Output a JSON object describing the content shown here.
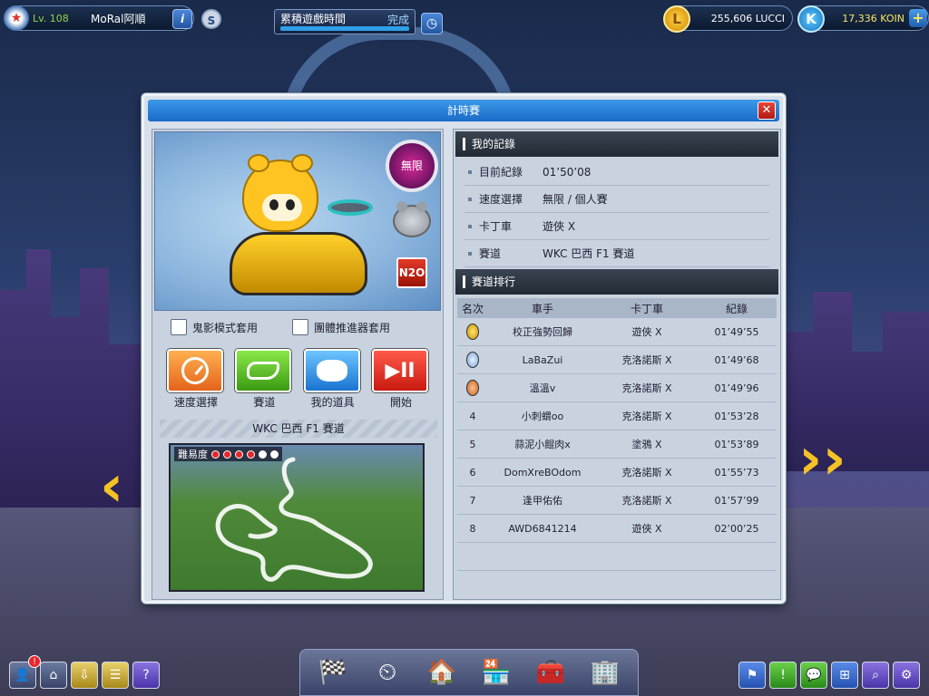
{
  "topbar": {
    "level": "Lv. 108",
    "nickname": "MoRal阿順",
    "quest_text": "累積遊戲時間",
    "quest_status": "完成",
    "quest_progress": 1.0,
    "lucci": "255,606 LUCCI",
    "koin": "17,336 KOIN",
    "lucci_symbol": "L",
    "koin_symbol": "K",
    "info_symbol": "i",
    "s_symbol": "S"
  },
  "window": {
    "title": "計時賽",
    "close_symbol": "✕",
    "kart": {
      "speed_badge": "無限",
      "n2o_badge": "N2O"
    },
    "checkboxes": [
      {
        "label": "鬼影模式套用",
        "checked": false
      },
      {
        "label": "團體推進器套用",
        "checked": false
      }
    ],
    "actions": [
      {
        "label": "速度選擇",
        "icon": "speed-gauge-icon"
      },
      {
        "label": "賽道",
        "icon": "track-icon"
      },
      {
        "label": "我的道具",
        "icon": "item-icon"
      },
      {
        "label": "開始",
        "icon": "start-icon"
      }
    ],
    "start_symbol": "▶II",
    "track_name": "WKC 巴西 F1 賽道",
    "difficulty": {
      "label": "難易度",
      "level": 4,
      "max": 6
    },
    "my_record": {
      "heading": "我的記錄",
      "rows": [
        {
          "key": "目前紀錄",
          "value": "01’50’08"
        },
        {
          "key": "速度選擇",
          "value": "無限 / 個人賽"
        },
        {
          "key": "卡丁車",
          "value": "遊俠 X"
        },
        {
          "key": "賽道",
          "value": "WKC 巴西 F1 賽道"
        }
      ]
    },
    "ranking": {
      "heading": "賽道排行",
      "columns": [
        "名次",
        "車手",
        "卡丁車",
        "紀錄"
      ],
      "rows": [
        {
          "rank": "",
          "medal": "gold",
          "driver": "校正強勢回歸",
          "kart": "遊俠 X",
          "record": "01’49’55"
        },
        {
          "rank": "",
          "medal": "silver",
          "driver": "LaBaZui",
          "kart": "克洛諾斯 X",
          "record": "01’49’68"
        },
        {
          "rank": "",
          "medal": "bronze",
          "driver": "溫溫v",
          "kart": "克洛諾斯 X",
          "record": "01’49’96"
        },
        {
          "rank": "4",
          "medal": "",
          "driver": "小刺蝟oo",
          "kart": "克洛諾斯 X",
          "record": "01’53’28"
        },
        {
          "rank": "5",
          "medal": "",
          "driver": "蒜泥小餛肉x",
          "kart": "塗鴉 X",
          "record": "01’53’89"
        },
        {
          "rank": "6",
          "medal": "",
          "driver": "DomXreBOdom",
          "kart": "克洛諾斯 X",
          "record": "01’55’73"
        },
        {
          "rank": "7",
          "medal": "",
          "driver": "逢甲佑佑",
          "kart": "克洛諾斯 X",
          "record": "01’57’99"
        },
        {
          "rank": "8",
          "medal": "",
          "driver": "AWD6841214",
          "kart": "遊俠 X",
          "record": "02’00’25"
        }
      ]
    }
  },
  "bottom": {
    "left_icons": [
      "profile-icon",
      "home-icon",
      "download-icon",
      "notes-icon",
      "help-icon"
    ],
    "left_symbols": [
      "👤",
      "⌂",
      "⇩",
      "☰",
      "?"
    ],
    "notify_symbol": "!",
    "center_icons": [
      "kart-garage-icon",
      "speedometer-icon",
      "workshop-icon",
      "shop-icon",
      "toolbox-icon",
      "building-icon"
    ],
    "center_symbols": [
      "🏁",
      "⏲",
      "🏠",
      "🏪",
      "🧰",
      "🏢"
    ],
    "right_icons": [
      "flag-icon",
      "alert-icon",
      "chat-icon",
      "board-icon",
      "search-icon",
      "settings-icon"
    ],
    "right_symbols": [
      "⚑",
      "!",
      "💬",
      "⊞",
      "⌕",
      "⚙"
    ]
  }
}
